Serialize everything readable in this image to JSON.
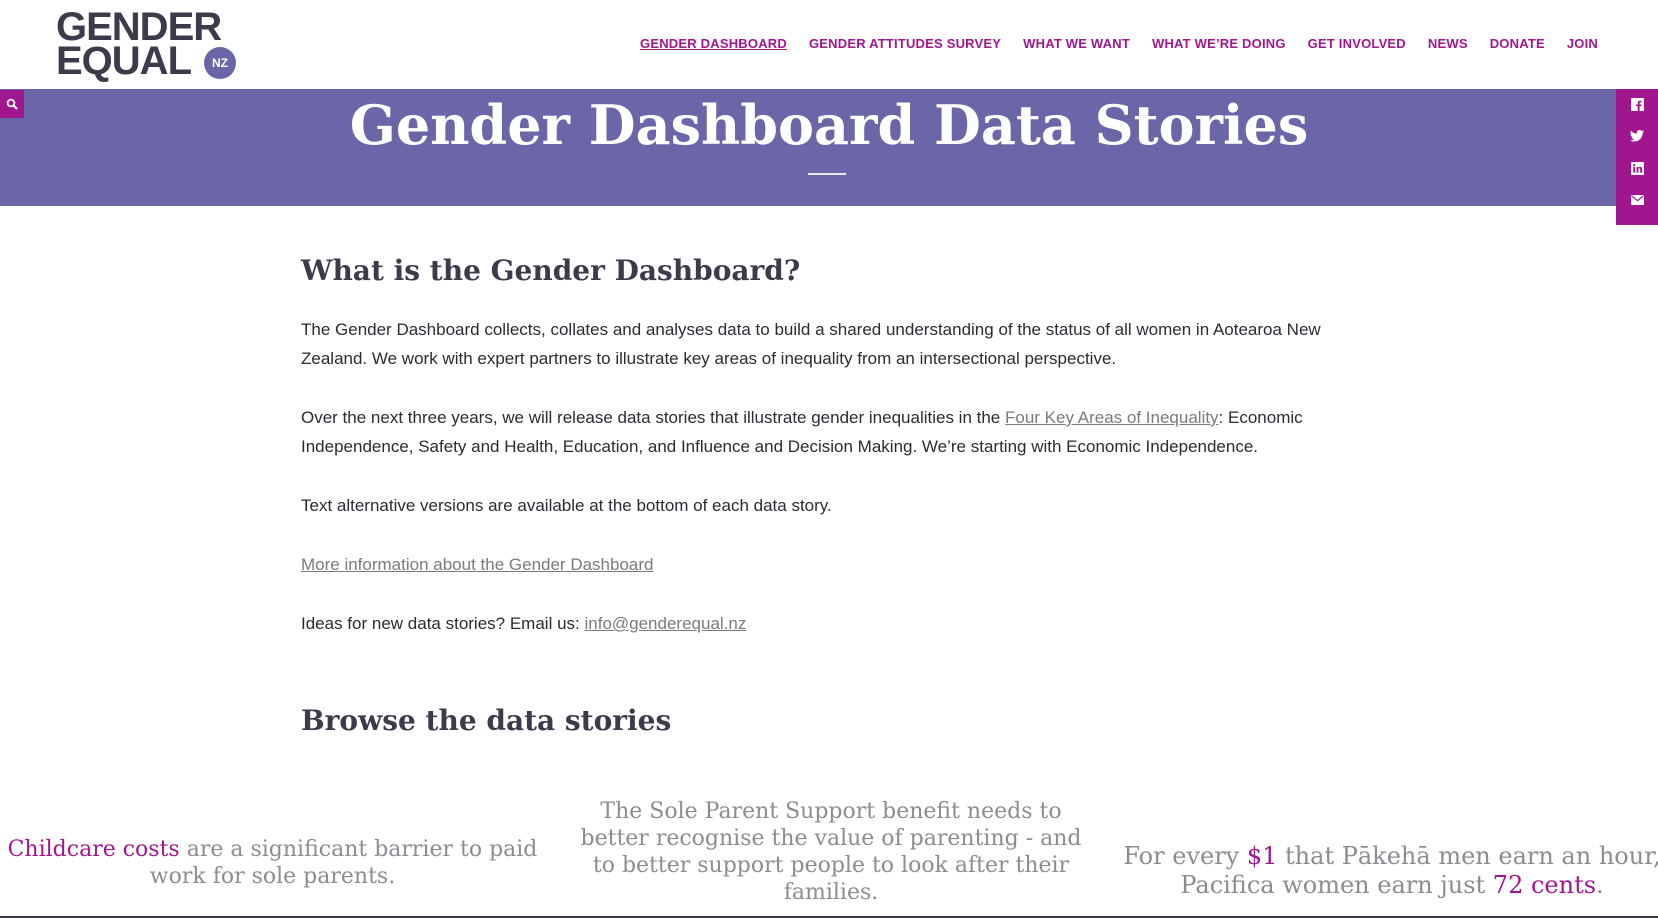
{
  "logo": {
    "line1": "GENDER",
    "line2": "EQUAL",
    "badge": "NZ"
  },
  "nav": [
    {
      "label": "GENDER DASHBOARD",
      "active": true
    },
    {
      "label": "GENDER ATTITUDES SURVEY"
    },
    {
      "label": "WHAT WE WANT"
    },
    {
      "label": "WHAT WE’RE DOING"
    },
    {
      "label": "GET INVOLVED"
    },
    {
      "label": "NEWS"
    },
    {
      "label": "DONATE"
    },
    {
      "label": "JOIN"
    }
  ],
  "banner": {
    "title": "Gender Dashboard Data Stories"
  },
  "icons": {
    "search": "search-icon",
    "social": [
      "facebook-icon",
      "twitter-icon",
      "linkedin-icon",
      "email-icon"
    ]
  },
  "content": {
    "heading1": "What is the Gender Dashboard?",
    "para1": "The Gender Dashboard collects, collates and analyses data to build a shared understanding of the status of all women in Aotearoa New Zealand. We work with expert partners to illustrate key areas of inequality from an intersectional perspective.",
    "para2_pre": "Over the next three years, we will release data stories that illustrate gender inequalities in the ",
    "para2_link": "Four Key Areas of Inequality",
    "para2_post": ": Economic Independence, Safety and Health, Education, and Influence and Decision Making. We’re starting with Economic Independence.",
    "para3": "Text alternative versions are available at the bottom of each data story.",
    "more_link": "More information about the Gender Dashboard",
    "ideas_pre": "Ideas for new data stories? Email us: ",
    "ideas_email": "info@genderequal.nz",
    "heading2": "Browse the data stories"
  },
  "stories": {
    "card1": {
      "highlight": "Childcare costs",
      "rest": " are a significant barrier to paid work for sole parents."
    },
    "card2": {
      "text": "The Sole Parent Support benefit needs to better recognise the value of parenting - and to better support people to look after their families."
    },
    "card3": {
      "t1": "For every ",
      "h1": "$1",
      "t2": " that Pākehā men earn an hour, Pacifica women earn just ",
      "h2": "72 cents",
      "t3": "."
    }
  },
  "colors": {
    "accent": "#a0168f",
    "banner": "#6b66a8",
    "heading": "#3d3a4b",
    "link": "#7a7a80"
  }
}
